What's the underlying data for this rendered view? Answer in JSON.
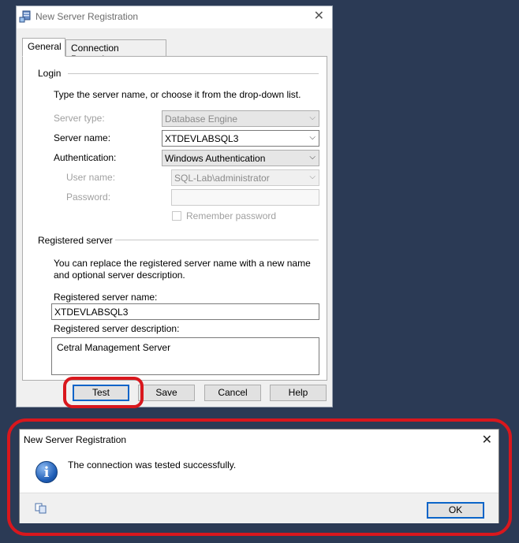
{
  "main_dialog": {
    "title": "New Server Registration",
    "close_glyph": "✕",
    "tabs": [
      {
        "label": "General",
        "active": true
      },
      {
        "label": "Connection Properties",
        "active": false
      }
    ],
    "login": {
      "section_label": "Login",
      "instruction": "Type the server name, or choose it from the drop-down list.",
      "server_type_label": "Server type:",
      "server_type_value": "Database Engine",
      "server_name_label": "Server name:",
      "server_name_value": "XTDEVLABSQL3",
      "authentication_label": "Authentication:",
      "authentication_value": "Windows Authentication",
      "user_name_label": "User name:",
      "user_name_value": "SQL-Lab\\administrator",
      "password_label": "Password:",
      "password_value": "",
      "remember_password_label": "Remember password"
    },
    "registered_server": {
      "section_label": "Registered server",
      "instruction_line1": "You can replace the registered server name with a new name",
      "instruction_line2": "and optional server description.",
      "name_label": "Registered server name:",
      "name_value": "XTDEVLABSQL3",
      "description_label": "Registered server description:",
      "description_value": "Cetral Management Server"
    },
    "buttons": {
      "test": "Test",
      "save": "Save",
      "cancel": "Cancel",
      "help": "Help"
    },
    "dropdown_glyph": "⌵"
  },
  "message_box": {
    "title": "New Server Registration",
    "close_glyph": "✕",
    "message": "The connection was tested successfully.",
    "info_glyph": "i",
    "ok_label": "OK"
  },
  "colors": {
    "background": "#2b3a55",
    "highlight": "#d9171d",
    "focus_border": "#0a64c8"
  },
  "icons": [
    "server-registration-icon",
    "close-icon",
    "chevron-down-icon",
    "info-icon",
    "copy-icon"
  ]
}
